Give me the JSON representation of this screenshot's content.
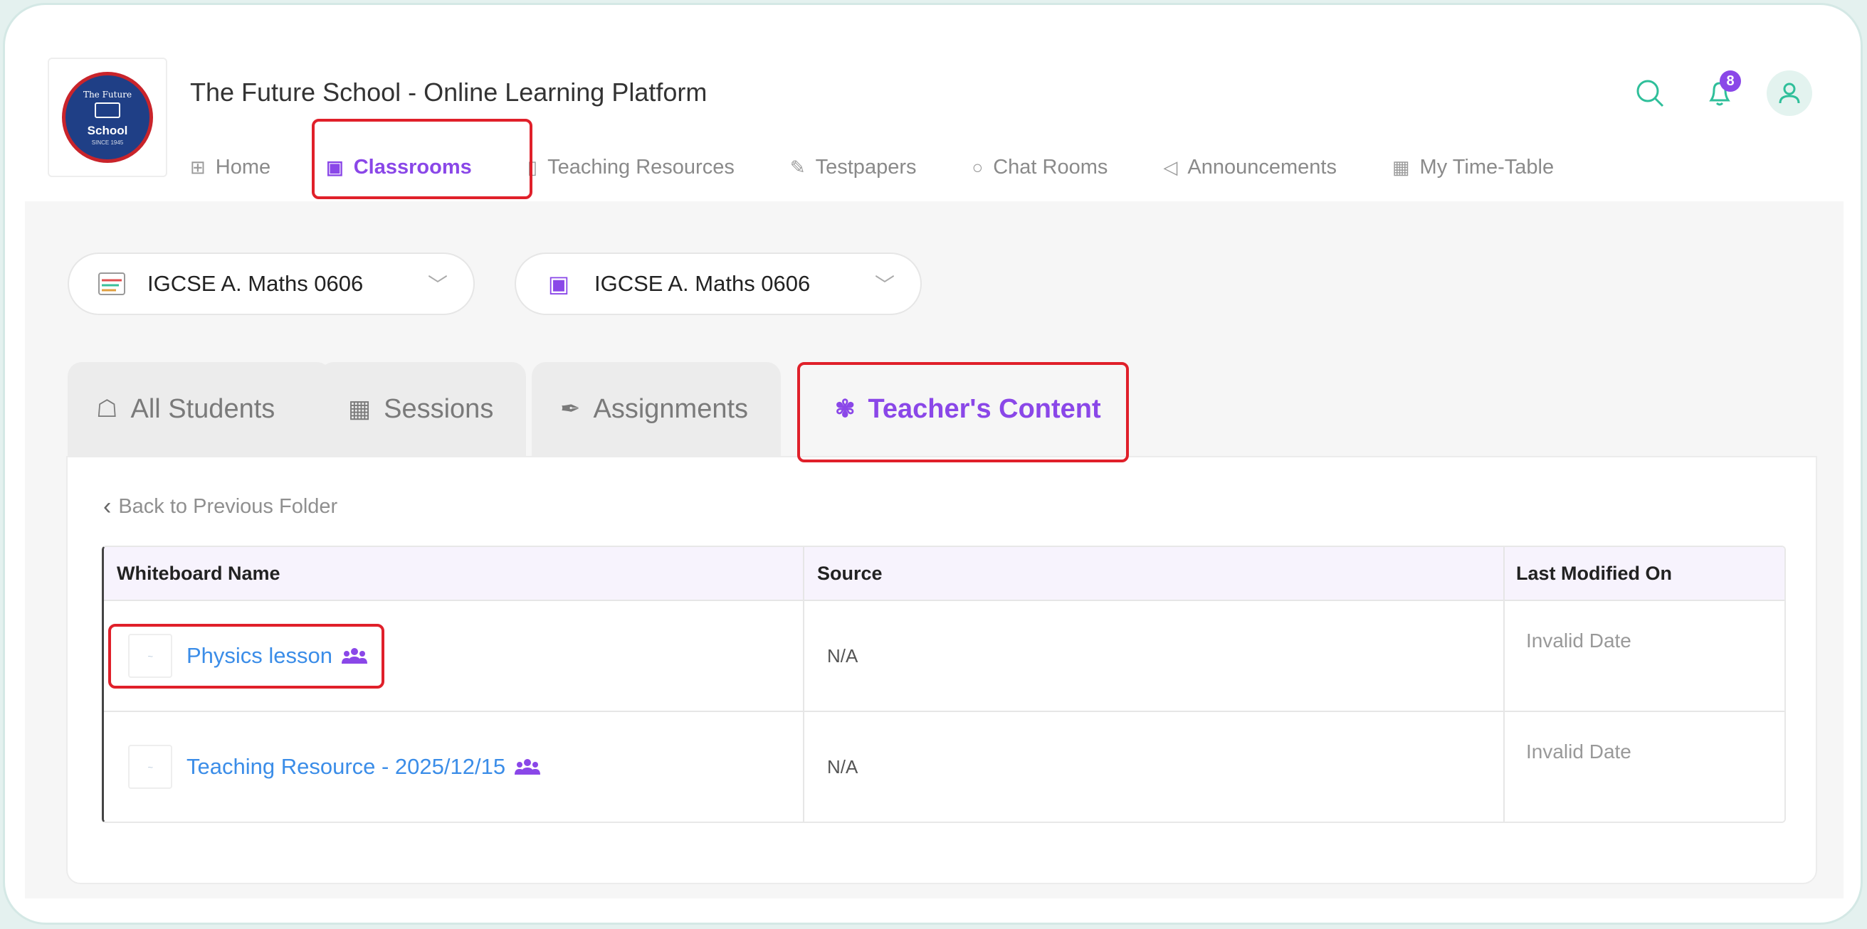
{
  "header": {
    "app_title": "The Future School - Online Learning Platform",
    "logo": {
      "line1": "The Future",
      "line2": "School",
      "line3": "SINCE 1945"
    },
    "notification_count": "8"
  },
  "nav": {
    "items": [
      {
        "label": "Home",
        "icon": "grid-icon",
        "active": false
      },
      {
        "label": "Classrooms",
        "icon": "presentation-board-icon",
        "active": true
      },
      {
        "label": "Teaching Resources",
        "icon": "open-book-icon",
        "active": false
      },
      {
        "label": "Testpapers",
        "icon": "document-edit-icon",
        "active": false
      },
      {
        "label": "Chat Rooms",
        "icon": "chat-bubble-icon",
        "active": false
      },
      {
        "label": "Announcements",
        "icon": "megaphone-icon",
        "active": false
      },
      {
        "label": "My Time-Table",
        "icon": "calendar-icon",
        "active": false
      }
    ]
  },
  "selectors": {
    "subject": "IGCSE A. Maths 0606",
    "classroom": "IGCSE A. Maths 0606"
  },
  "tabs": [
    {
      "label": "All Students",
      "icon": "student-icon",
      "active": false
    },
    {
      "label": "Sessions",
      "icon": "calendar-icon",
      "active": false
    },
    {
      "label": "Assignments",
      "icon": "pen-nib-icon",
      "active": false
    },
    {
      "label": "Teacher's Content",
      "icon": "teacher-content-icon",
      "active": true
    }
  ],
  "content": {
    "back_label": "Back to Previous Folder",
    "columns": [
      "Whiteboard Name",
      "Source",
      "Last Modified On"
    ],
    "rows": [
      {
        "name": "Physics lesson",
        "source": "N/A",
        "modified": "Invalid Date"
      },
      {
        "name": "Teaching Resource - 2025/12/15",
        "source": "N/A",
        "modified": "Invalid Date"
      }
    ]
  },
  "colors": {
    "accent": "#8a47e8",
    "highlight": "#e0202a",
    "header_icons": "#2fbf9a",
    "link": "#3b8de8"
  }
}
